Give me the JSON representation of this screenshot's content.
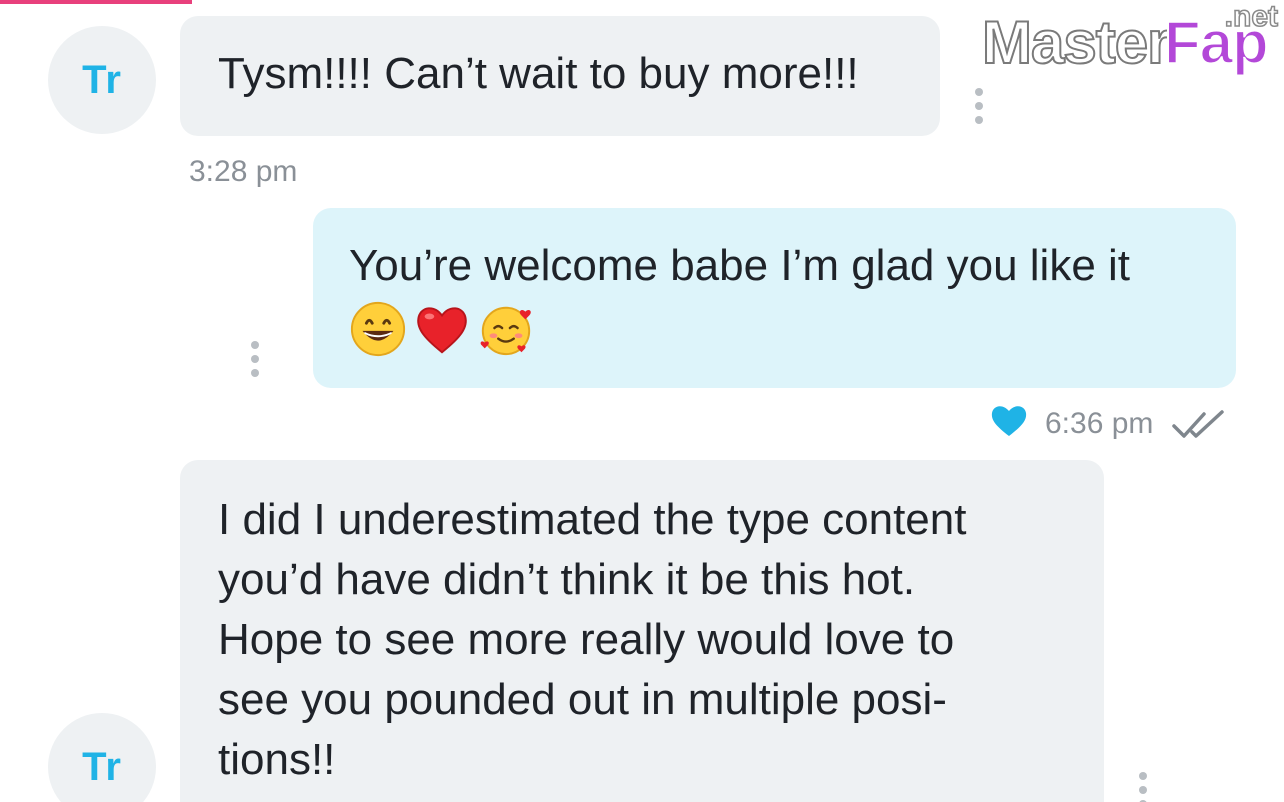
{
  "watermark": {
    "main": "Master",
    "accent": "Fap",
    "suffix": ".net"
  },
  "messages": [
    {
      "direction": "incoming",
      "avatar": "Tr",
      "text": "Tysm!!!! Can’t wait to buy more!!!",
      "time": "3:28 pm"
    },
    {
      "direction": "outgoing",
      "text": "You’re welcome babe I’m glad you like it",
      "emojis": [
        "grinning-face",
        "red-heart",
        "smiling-face-with-hearts"
      ],
      "time": "6:36 pm",
      "liked": true,
      "status": "read"
    },
    {
      "direction": "incoming",
      "avatar": "Tr",
      "text": "I did I underestimated the type content\nyou’d have didn’t think it be this hot.\nHope to see more really would love to\nsee you pounded out in multiple posi-\ntions!!"
    }
  ],
  "colors": {
    "accent": "#1fb3e6",
    "incoming_bubble": "#eef1f3",
    "outgoing_bubble": "#ddf4fa",
    "timestamp": "#8a9097",
    "top_bar": "#e8407c"
  }
}
